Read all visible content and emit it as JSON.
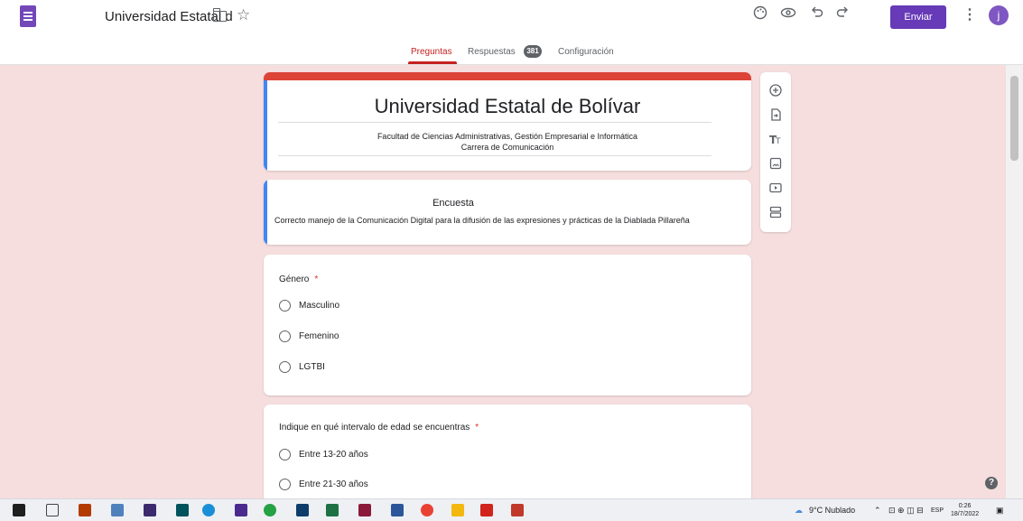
{
  "header": {
    "doc_title": "Universidad Estatal d",
    "send_label": "Enviar",
    "avatar_letter": "j",
    "accent_color": "#673ab7"
  },
  "tabs": [
    {
      "label": "Preguntas",
      "active": true
    },
    {
      "label": "Respuestas",
      "active": false
    },
    {
      "label": "Configuración",
      "active": false
    }
  ],
  "responses_count": "381",
  "form": {
    "title": "Universidad Estatal de Bolívar",
    "subtitle_line1": "Facultad de Ciencias Administrativas, Gestión Empresarial e Informática",
    "subtitle_line2": "Carrera de Comunicación"
  },
  "section": {
    "title": "Encuesta",
    "description": "Correcto manejo de la Comunicación Digital  para la difusión de las expresiones y prácticas de la Diablada Pillareña"
  },
  "questions": [
    {
      "text": "Género",
      "required_mark": "*",
      "options": [
        "Masculino",
        "Femenino",
        "LGTBI"
      ]
    },
    {
      "text": "Indique en qué intervalo de edad se encuentras",
      "required_mark": "*",
      "options": [
        "Entre 13-20 años",
        "Entre 21-30 años"
      ]
    }
  ],
  "side_toolbar": [
    "add-question-icon",
    "import-questions-icon",
    "add-title-icon",
    "add-image-icon",
    "add-video-icon",
    "add-section-icon"
  ],
  "taskbar": {
    "weather": "9°C Nublado",
    "language": "ESP",
    "time": "0:26",
    "date": "18/7/2022"
  },
  "help_glyph": "?"
}
